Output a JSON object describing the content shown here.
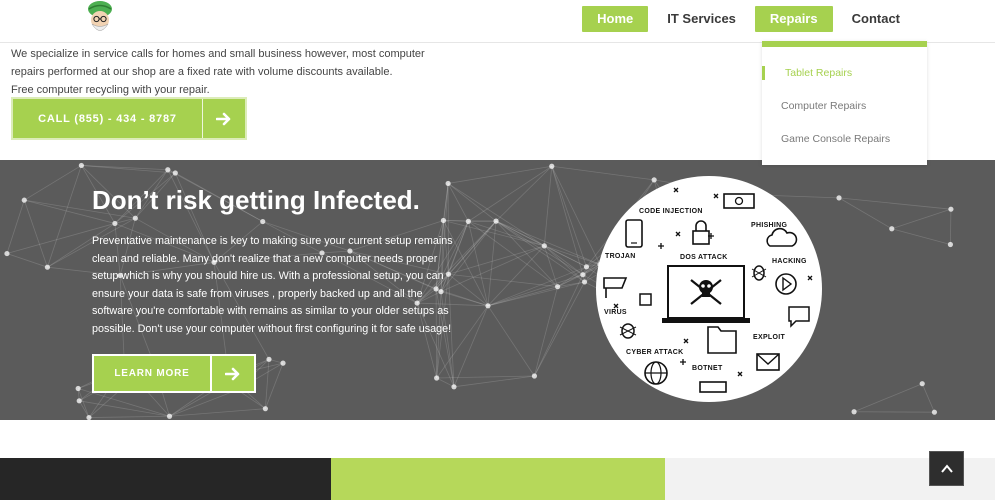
{
  "nav": {
    "items": [
      {
        "label": "Home",
        "active": true
      },
      {
        "label": "IT Services",
        "active": false
      },
      {
        "label": "Repairs",
        "active": true
      },
      {
        "label": "Contact",
        "active": false
      }
    ]
  },
  "dropdown": {
    "items": [
      "Tablet Repairs",
      "Computer Repairs",
      "Game Console Repairs"
    ]
  },
  "intro": {
    "line1": "We specialize in service calls for homes and small business however, most computer",
    "line2": "repairs performed at our shop are a fixed rate with volume discounts available.",
    "line3": "Free computer recycling with your repair."
  },
  "call_button": {
    "label": "CALL (855) - 434 - 8787"
  },
  "infected": {
    "headline": "Don’t risk getting Infected.",
    "lines": [
      "Preventative maintenance is key to making sure your current setup remains",
      "clean and reliable. Many don't realize that a new computer needs proper",
      "setup which is why you should hire us. With a professional setup, you can",
      "ensure your data is safe from viruses , properly backed up and all the",
      "software you're comfortable with remains as similar to your older setups as",
      "possible. Don't use your computer without first configuring it for safe usage!"
    ],
    "learn_more": "LEARN MORE"
  },
  "threat_graphic": {
    "labels": {
      "code_injection": "CODE INJECTION",
      "phishing": "PHISHING",
      "trojan": "TROJAN",
      "dos_attack": "DOS ATTACK",
      "hacking": "HACKING",
      "virus": "VIRUS",
      "exploit": "EXPLOIT",
      "cyber_attack": "CYBER ATTACK",
      "botnet": "BOTNET"
    }
  },
  "colors": {
    "accent": "#a6d14f",
    "dark_section": "#5b5b5b",
    "footer_dark": "#262626",
    "footer_green": "#b6d85a",
    "footer_light": "#f2f2f2"
  },
  "icons": [
    "logo-icon",
    "arrow-right-icon",
    "chevron-up-icon",
    "skull-icon",
    "cloud-icon",
    "lock-icon",
    "globe-icon",
    "envelope-icon",
    "phone-icon",
    "folder-icon",
    "bug-icon"
  ]
}
